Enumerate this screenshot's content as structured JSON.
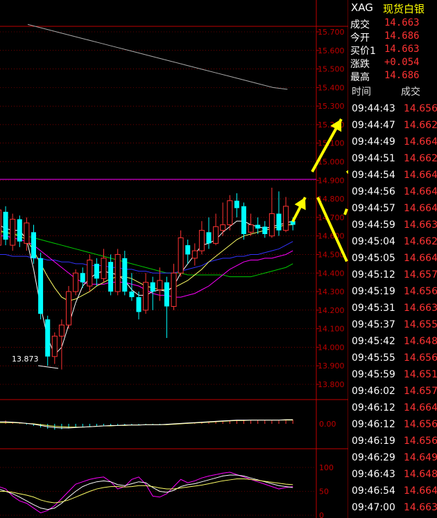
{
  "header": {
    "code": "XAG",
    "name": "现货白银"
  },
  "quote": [
    {
      "label": "成交",
      "value": "14.663"
    },
    {
      "label": "今开",
      "value": "14.686"
    },
    {
      "label": "买价1",
      "value": "14.663"
    },
    {
      "label": "涨跌",
      "value": "+0.054"
    },
    {
      "label": "最高",
      "value": "14.686"
    }
  ],
  "ticks_header": {
    "time": "时间",
    "price": "成交"
  },
  "ticks": [
    {
      "time": "09:44:43",
      "price": "14.656"
    },
    {
      "time": "09:44:47",
      "price": "14.662"
    },
    {
      "time": "09:44:49",
      "price": "14.664"
    },
    {
      "time": "09:44:51",
      "price": "14.662"
    },
    {
      "time": "09:44:54",
      "price": "14.664"
    },
    {
      "time": "09:44:56",
      "price": "14.664"
    },
    {
      "time": "09:44:57",
      "price": "14.664"
    },
    {
      "time": "09:44:59",
      "price": "14.663"
    },
    {
      "time": "09:45:04",
      "price": "14.662"
    },
    {
      "time": "09:45:05",
      "price": "14.664"
    },
    {
      "time": "09:45:12",
      "price": "14.657"
    },
    {
      "time": "09:45:19",
      "price": "14.656"
    },
    {
      "time": "09:45:31",
      "price": "14.663"
    },
    {
      "time": "09:45:37",
      "price": "14.655"
    },
    {
      "time": "09:45:42",
      "price": "14.648"
    },
    {
      "time": "09:45:55",
      "price": "14.656"
    },
    {
      "time": "09:45:59",
      "price": "14.651"
    },
    {
      "time": "09:46:02",
      "price": "14.657"
    },
    {
      "time": "09:46:12",
      "price": "14.664"
    },
    {
      "time": "09:46:12",
      "price": "14.656"
    },
    {
      "time": "09:46:19",
      "price": "14.656"
    },
    {
      "time": "09:46:29",
      "price": "14.649"
    },
    {
      "time": "09:46:43",
      "price": "14.648"
    },
    {
      "time": "09:46:54",
      "price": "14.664"
    },
    {
      "time": "09:47:00",
      "price": "14.663"
    }
  ],
  "colors": {
    "up": "#ff3333",
    "down": "#00ffff",
    "axis": "#c00000",
    "ma_white": "#ffffff",
    "ma_yellow": "#ffff66",
    "ma_magenta": "#ff00ff",
    "ma_green": "#00cc00",
    "ma_blue": "#3333ff",
    "arrow": "#ffff00"
  },
  "chart_data": [
    {
      "type": "candlestick",
      "ylim": [
        13.75,
        15.75
      ],
      "yticks": [
        "15.700",
        "15.600",
        "15.500",
        "15.400",
        "15.300",
        "15.200",
        "15.100",
        "15.000",
        "14.900",
        "14.800",
        "14.700",
        "14.600",
        "14.500",
        "14.400",
        "14.300",
        "14.200",
        "14.100",
        "14.000",
        "13.900",
        "13.800"
      ],
      "annotation": "13.873",
      "hline": 14.905,
      "candles": [
        [
          14.55,
          14.74,
          14.78,
          14.5
        ],
        [
          14.73,
          14.58,
          14.76,
          14.55
        ],
        [
          14.55,
          14.69,
          14.72,
          14.52
        ],
        [
          14.69,
          14.57,
          14.71,
          14.54
        ],
        [
          14.56,
          14.67,
          14.7,
          14.52
        ],
        [
          14.62,
          14.48,
          14.66,
          14.45
        ],
        [
          14.48,
          14.18,
          14.51,
          14.15
        ],
        [
          14.15,
          13.95,
          14.17,
          13.9
        ],
        [
          13.95,
          14.06,
          14.08,
          13.91
        ],
        [
          14.06,
          14.12,
          14.15,
          13.88
        ],
        [
          14.12,
          14.3,
          14.33,
          14.1
        ],
        [
          14.3,
          14.4,
          14.42,
          14.28
        ],
        [
          14.4,
          14.35,
          14.43,
          14.32
        ],
        [
          14.33,
          14.47,
          14.5,
          14.3
        ],
        [
          14.45,
          14.37,
          14.48,
          14.33
        ],
        [
          14.37,
          14.48,
          14.53,
          14.35
        ],
        [
          14.46,
          14.3,
          14.5,
          14.28
        ],
        [
          14.3,
          14.5,
          14.53,
          14.28
        ],
        [
          14.48,
          14.3,
          14.52,
          14.28
        ],
        [
          14.3,
          14.27,
          14.4,
          14.25
        ],
        [
          14.27,
          14.19,
          14.3,
          14.15
        ],
        [
          14.2,
          14.35,
          14.4,
          14.18
        ],
        [
          14.35,
          14.3,
          14.38,
          14.2
        ],
        [
          14.31,
          14.36,
          14.43,
          14.25
        ],
        [
          14.35,
          14.22,
          14.38,
          14.05
        ],
        [
          14.22,
          14.4,
          14.45,
          14.2
        ],
        [
          14.4,
          14.59,
          14.63,
          14.38
        ],
        [
          14.55,
          14.5,
          14.58,
          14.45
        ],
        [
          14.48,
          14.52,
          14.56,
          14.44
        ],
        [
          14.52,
          14.63,
          14.68,
          14.5
        ],
        [
          14.62,
          14.56,
          14.7,
          14.53
        ],
        [
          14.56,
          14.65,
          14.72,
          14.55
        ],
        [
          14.63,
          14.66,
          14.78,
          14.6
        ],
        [
          14.66,
          14.79,
          14.82,
          14.63
        ],
        [
          14.79,
          14.75,
          14.83,
          14.7
        ],
        [
          14.76,
          14.61,
          14.78,
          14.58
        ],
        [
          14.62,
          14.66,
          14.72,
          14.6
        ],
        [
          14.66,
          14.64,
          14.7,
          14.61
        ],
        [
          14.65,
          14.61,
          14.68,
          14.59
        ],
        [
          14.6,
          14.72,
          14.86,
          14.59
        ],
        [
          14.72,
          14.63,
          14.84,
          14.6
        ],
        [
          14.63,
          14.76,
          14.81,
          14.62
        ],
        [
          14.68,
          14.66,
          14.7,
          14.63
        ]
      ],
      "ma_white": [
        14.66,
        14.64,
        14.63,
        14.63,
        14.58,
        14.42,
        14.22,
        14.05,
        13.96,
        14.0,
        14.12,
        14.24,
        14.33,
        14.37,
        14.4,
        14.41,
        14.4,
        14.39,
        14.36,
        14.31,
        14.28,
        14.28,
        14.3,
        14.31,
        14.3,
        14.33,
        14.4,
        14.45,
        14.5,
        14.55,
        14.56,
        14.58,
        14.62,
        14.65,
        14.68,
        14.68,
        14.66,
        14.65,
        14.64,
        14.65,
        14.66,
        14.67,
        14.68
      ],
      "ma_yellow": [
        14.63,
        14.62,
        14.61,
        14.6,
        14.58,
        14.52,
        14.45,
        14.38,
        14.32,
        14.27,
        14.25,
        14.26,
        14.28,
        14.3,
        14.33,
        14.35,
        14.37,
        14.38,
        14.38,
        14.37,
        14.35,
        14.33,
        14.32,
        14.31,
        14.31,
        14.32,
        14.34,
        14.36,
        14.39,
        14.42,
        14.46,
        14.49,
        14.52,
        14.55,
        14.58,
        14.6,
        14.61,
        14.62,
        14.63,
        14.64,
        14.65,
        14.66,
        14.66
      ],
      "ma_magenta": [
        14.6,
        14.6,
        14.59,
        14.58,
        14.57,
        14.55,
        14.52,
        14.49,
        14.46,
        14.43,
        14.4,
        14.37,
        14.35,
        14.34,
        14.34,
        14.34,
        14.35,
        14.35,
        14.35,
        14.34,
        14.33,
        14.31,
        14.29,
        14.28,
        14.28,
        14.27,
        14.27,
        14.28,
        14.29,
        14.31,
        14.33,
        14.36,
        14.39,
        14.42,
        14.44,
        14.46,
        14.47,
        14.47,
        14.48,
        14.48,
        14.49,
        14.5,
        14.52
      ],
      "ma_green": [
        14.62,
        14.62,
        14.61,
        14.61,
        14.6,
        14.59,
        14.58,
        14.57,
        14.56,
        14.55,
        14.54,
        14.53,
        14.52,
        14.51,
        14.5,
        14.49,
        14.48,
        14.47,
        14.46,
        14.45,
        14.44,
        14.43,
        14.42,
        14.41,
        14.4,
        14.4,
        14.4,
        14.39,
        14.39,
        14.39,
        14.39,
        14.39,
        14.39,
        14.38,
        14.38,
        14.38,
        14.38,
        14.39,
        14.4,
        14.41,
        14.42,
        14.43,
        14.45
      ],
      "ma_blue": [
        14.5,
        14.5,
        14.49,
        14.49,
        14.49,
        14.48,
        14.48,
        14.47,
        14.47,
        14.46,
        14.46,
        14.45,
        14.45,
        14.44,
        14.44,
        14.44,
        14.43,
        14.43,
        14.42,
        14.42,
        14.41,
        14.41,
        14.4,
        14.4,
        14.4,
        14.4,
        14.41,
        14.42,
        14.43,
        14.44,
        14.46,
        14.47,
        14.48,
        14.48,
        14.49,
        14.49,
        14.5,
        14.5,
        14.51,
        14.52,
        14.53,
        14.55,
        14.57
      ],
      "upper_line": [
        15.74,
        15.72,
        15.7,
        15.68,
        15.66,
        15.64,
        15.62,
        15.6,
        15.58,
        15.56,
        15.54,
        15.52,
        15.5,
        15.48,
        15.46,
        15.44,
        15.42,
        15.4,
        15.39
      ]
    },
    {
      "type": "bar",
      "ytick": "0.00",
      "values": [
        0.6,
        0.8,
        0.5,
        0.3,
        -0.2,
        -0.5,
        -0.9,
        -1.2,
        -1.4,
        -1.3,
        -1.1,
        -0.9,
        -0.7,
        -0.6,
        -0.5,
        -0.4,
        -0.4,
        -0.3,
        -0.3,
        -0.3,
        -0.3,
        -0.2,
        -0.2,
        -0.2,
        -0.2,
        -0.1,
        0.1,
        0.2,
        0.3,
        0.4,
        0.5,
        0.6,
        0.7,
        0.8,
        0.9,
        1.0,
        1.0,
        0.9,
        0.9,
        0.8,
        0.8,
        0.9,
        1.0
      ],
      "line_yellow": [
        0.3,
        0.3,
        0.3,
        0.2,
        0.1,
        0.0,
        -0.2,
        -0.4,
        -0.6,
        -0.7,
        -0.8,
        -0.8,
        -0.8,
        -0.7,
        -0.6,
        -0.5,
        -0.5,
        -0.4,
        -0.4,
        -0.3,
        -0.3,
        -0.2,
        -0.2,
        -0.2,
        -0.2,
        -0.1,
        0.0,
        0.1,
        0.2,
        0.3,
        0.4,
        0.5,
        0.6,
        0.7,
        0.8,
        0.8,
        0.9,
        0.9,
        0.9,
        0.9,
        0.9,
        0.9,
        0.9
      ],
      "line_white": [
        0.5,
        0.5,
        0.4,
        0.3,
        0.1,
        -0.1,
        -0.4,
        -0.7,
        -0.9,
        -1.0,
        -1.0,
        -0.9,
        -0.8,
        -0.7,
        -0.6,
        -0.5,
        -0.4,
        -0.4,
        -0.3,
        -0.3,
        -0.3,
        -0.2,
        -0.2,
        -0.2,
        -0.1,
        0.0,
        0.1,
        0.2,
        0.3,
        0.4,
        0.5,
        0.6,
        0.7,
        0.8,
        0.9,
        0.9,
        0.9,
        0.9,
        0.9,
        0.9,
        0.9,
        1.0,
        1.0
      ]
    },
    {
      "type": "line",
      "ylim": [
        0,
        110
      ],
      "yticks": [
        "100",
        "50",
        "0"
      ],
      "series": [
        {
          "values": [
            60,
            55,
            40,
            30,
            25,
            15,
            5,
            10,
            20,
            35,
            50,
            65,
            70,
            75,
            78,
            80,
            70,
            55,
            60,
            75,
            80,
            65,
            40,
            38,
            45,
            60,
            75,
            68,
            72,
            78,
            82,
            85,
            88,
            90,
            85,
            80,
            75,
            70,
            65,
            60,
            55,
            58,
            60
          ]
        },
        {
          "values": [
            55,
            50,
            45,
            38,
            30,
            22,
            15,
            12,
            15,
            25,
            38,
            50,
            60,
            66,
            70,
            72,
            70,
            64,
            62,
            66,
            70,
            68,
            58,
            50,
            48,
            52,
            60,
            64,
            66,
            70,
            74,
            78,
            82,
            84,
            84,
            82,
            78,
            74,
            70,
            66,
            62,
            60,
            58
          ]
        },
        {
          "values": [
            50,
            50,
            48,
            45,
            42,
            38,
            32,
            28,
            26,
            28,
            32,
            38,
            44,
            50,
            55,
            58,
            60,
            60,
            59,
            60,
            62,
            62,
            60,
            57,
            55,
            55,
            57,
            59,
            61,
            63,
            66,
            69,
            72,
            74,
            76,
            76,
            75,
            73,
            71,
            69,
            67,
            65,
            64
          ]
        }
      ]
    }
  ]
}
